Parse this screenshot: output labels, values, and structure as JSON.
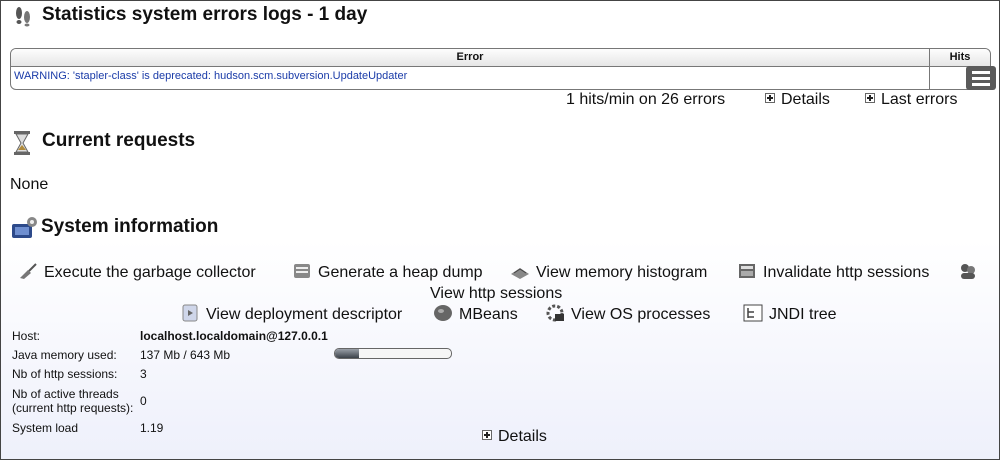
{
  "errors_section": {
    "title": "Statistics system errors logs - 1 day",
    "table": {
      "headers": [
        "Error",
        "Hits"
      ],
      "rows": [
        {
          "error": "WARNING: 'stapler-class' is deprecated: hudson.scm.subversion.UpdateUpdater",
          "hits": ""
        }
      ]
    },
    "summary": "1 hits/min on 26 errors",
    "details_label": "Details",
    "last_errors_label": "Last errors"
  },
  "requests_section": {
    "title": "Current requests",
    "content": "None"
  },
  "system_section": {
    "title": "System information",
    "actions": [
      {
        "label": "Execute the garbage collector",
        "icon": "broom-icon"
      },
      {
        "label": "Generate a heap dump",
        "icon": "heap-dump-icon"
      },
      {
        "label": "View memory histogram",
        "icon": "memory-histogram-icon"
      },
      {
        "label": "Invalidate http sessions",
        "icon": "invalidate-sessions-icon"
      },
      {
        "label": "View http sessions",
        "icon": "sessions-icon"
      },
      {
        "label": "View deployment descriptor",
        "icon": "deployment-descriptor-icon"
      },
      {
        "label": "MBeans",
        "icon": "mbeans-icon"
      },
      {
        "label": "View OS processes",
        "icon": "os-processes-icon"
      },
      {
        "label": "JNDI tree",
        "icon": "jndi-tree-icon"
      }
    ],
    "info": [
      {
        "label": "Host:",
        "value": "localhost.localdomain@127.0.0.1"
      },
      {
        "label": "Java memory used:",
        "value": "137 Mb / 643 Mb"
      },
      {
        "label": "Nb of http sessions:",
        "value": "3"
      },
      {
        "label": "Nb of active threads (current http requests):",
        "label_line1": "Nb of active threads",
        "label_line2": "(current http requests):",
        "value": "0"
      },
      {
        "label": "System load",
        "value": "1.19"
      }
    ],
    "memory_usage_percent": 21,
    "details_label": "Details"
  }
}
